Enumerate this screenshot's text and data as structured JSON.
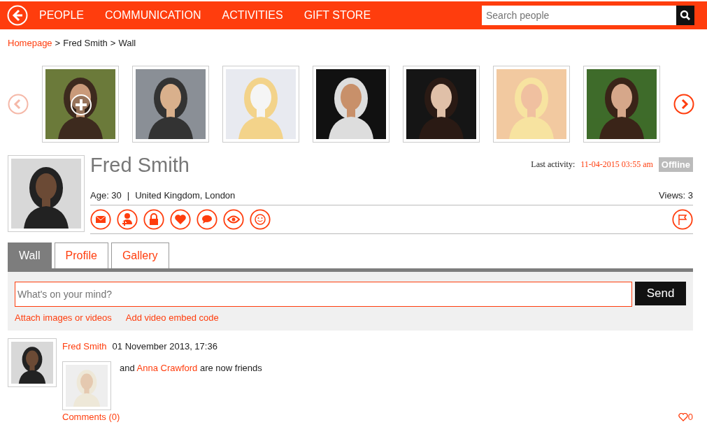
{
  "nav": {
    "items": [
      "PEOPLE",
      "COMMUNICATION",
      "ACTIVITIES",
      "GIFT STORE"
    ],
    "search": {
      "placeholder": "Search people"
    }
  },
  "breadcrumb": [
    {
      "text": "Homepage",
      "link": true
    },
    {
      "text": ">",
      "link": false
    },
    {
      "text": "Fred Smith",
      "link": false
    },
    {
      "text": ">",
      "link": false
    },
    {
      "text": "Wall",
      "link": false
    }
  ],
  "carousel": [
    {
      "kind": "picture",
      "add_overlay": true
    },
    {
      "kind": "picture",
      "add_overlay": false
    },
    {
      "kind": "picture",
      "add_overlay": false
    },
    {
      "kind": "picture",
      "add_overlay": false
    },
    {
      "kind": "picture",
      "add_overlay": false
    },
    {
      "kind": "picture",
      "add_overlay": false
    },
    {
      "kind": "picture",
      "add_overlay": false
    }
  ],
  "profile": {
    "name": "Fred Smith",
    "last_activity_label": "Last activity:",
    "last_activity": "11-04-2015 03:55 am",
    "status": "Offline",
    "age": "Age: 30",
    "separator": "|",
    "location": "United Kingdom, London",
    "views": "Views: 3"
  },
  "tabs": [
    {
      "label": "Wall",
      "selected": true
    },
    {
      "label": "Profile",
      "selected": false
    },
    {
      "label": "Gallery",
      "selected": false
    }
  ],
  "composer": {
    "placeholder": "What's on your mind?",
    "send": "Send",
    "links": [
      "Attach images or videos",
      "Add video embed code"
    ]
  },
  "feed": [
    {
      "author": "Fred Smith",
      "time": "01 November 2013, 17:36",
      "text_before": "and",
      "friend": "Anna Crawford",
      "text_after": "are now friends",
      "comments": "Comments (0)",
      "likes": "0"
    }
  ]
}
